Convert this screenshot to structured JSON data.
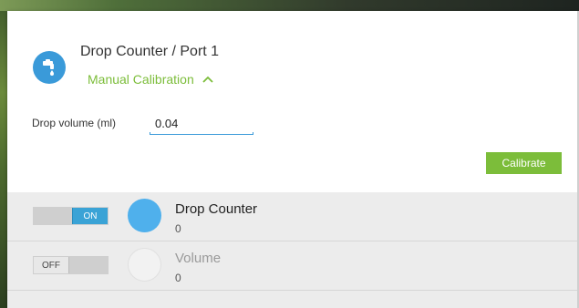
{
  "header": {
    "title": "Drop Counter / Port 1",
    "subtitle": "Manual Calibration",
    "icon": "faucet-drop-icon",
    "accent_color": "#7cbd3a",
    "icon_color": "#3a9ad9"
  },
  "form": {
    "drop_volume_label": "Drop volume (ml)",
    "drop_volume_value": "0.04",
    "calibrate_label": "Calibrate"
  },
  "sensors": [
    {
      "toggle_label": "ON",
      "title": "Drop Counter",
      "value": "0",
      "enabled": true,
      "dot_color": "#4fb0ec"
    },
    {
      "toggle_label": "OFF",
      "title": "Volume",
      "value": "0",
      "enabled": false,
      "dot_color": "#f2f2f2"
    }
  ]
}
